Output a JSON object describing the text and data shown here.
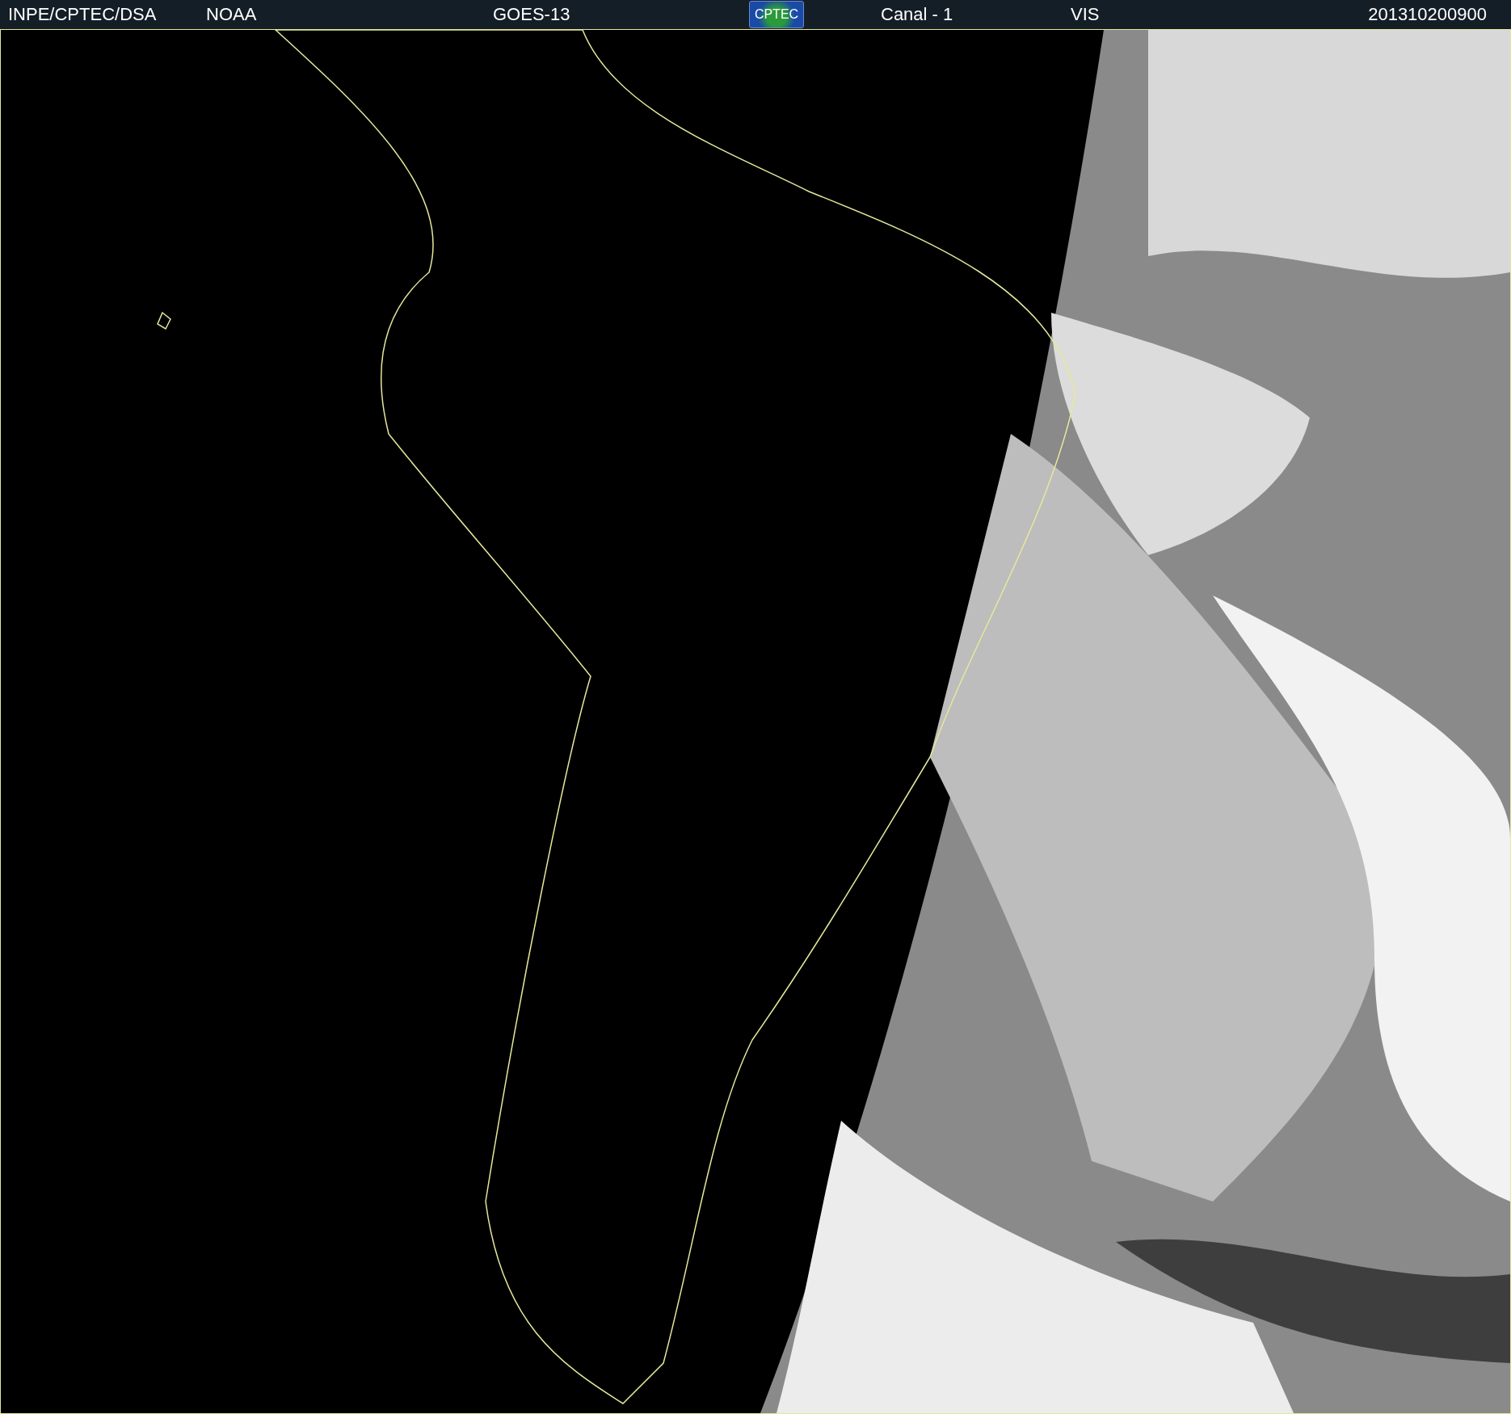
{
  "header": {
    "source": "INPE/CPTEC/DSA",
    "agency": "NOAA",
    "satellite": "GOES-13",
    "logo": "CPTEC",
    "channel": "Canal - 1",
    "band": "VIS",
    "timestamp": "201310200900"
  }
}
